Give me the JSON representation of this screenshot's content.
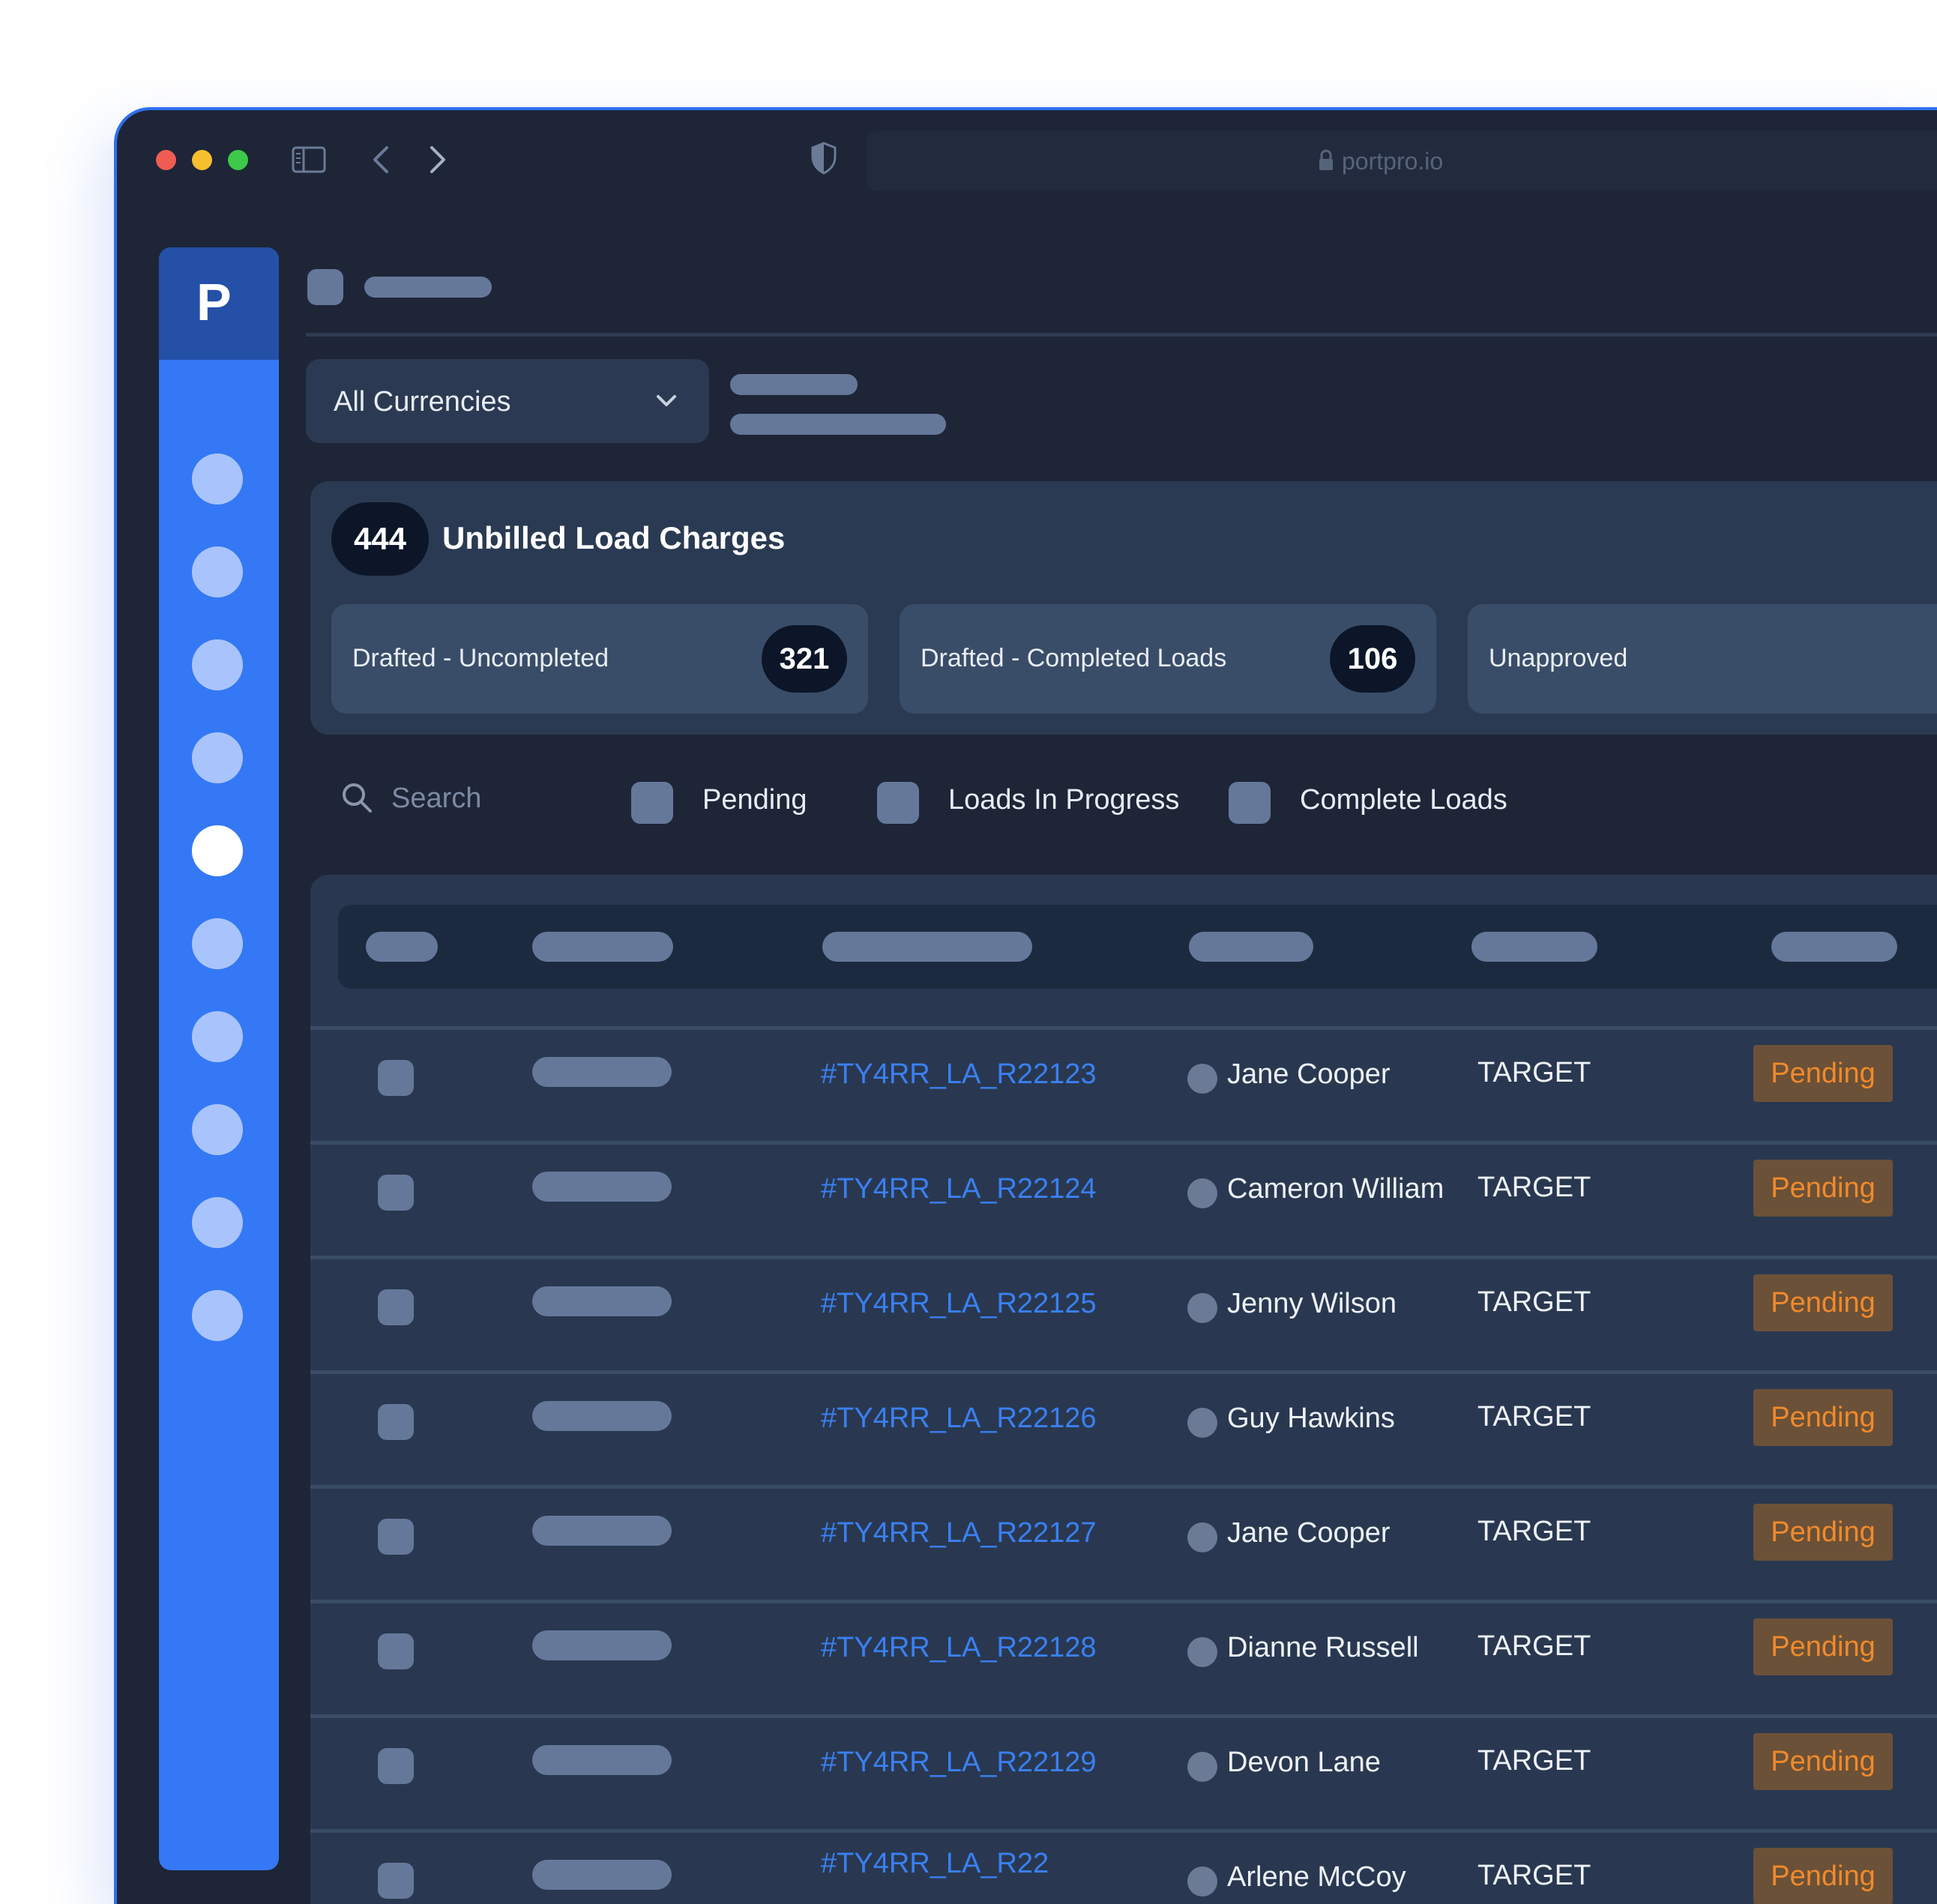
{
  "browser": {
    "url": "portpro.io",
    "traffic_lights": [
      "#ee5c53",
      "#f5bf2f",
      "#3dc94a"
    ]
  },
  "sidebar": {
    "logo": "P",
    "active_index": 4
  },
  "currency_select": {
    "value": "All Currencies"
  },
  "summary": {
    "total_count": "444",
    "title": "Unbilled Load Charges",
    "cards": [
      {
        "label": "Drafted - Uncompleted",
        "count": "321"
      },
      {
        "label": "Drafted - Completed Loads",
        "count": "106"
      },
      {
        "label": "Unapproved",
        "count": ""
      }
    ]
  },
  "filters": {
    "search_placeholder": "Search",
    "options": [
      "Pending",
      "Loads In Progress",
      "Complete Loads"
    ]
  },
  "rows": [
    {
      "id": "#TY4RR_LA_R22123",
      "name": "Jane Cooper",
      "customer": "TARGET",
      "status": "Pending"
    },
    {
      "id": "#TY4RR_LA_R22124",
      "name": "Cameron William",
      "customer": "TARGET",
      "status": "Pending"
    },
    {
      "id": "#TY4RR_LA_R22125",
      "name": "Jenny Wilson",
      "customer": "TARGET",
      "status": "Pending"
    },
    {
      "id": "#TY4RR_LA_R22126",
      "name": "Guy Hawkins",
      "customer": "TARGET",
      "status": "Pending"
    },
    {
      "id": "#TY4RR_LA_R22127",
      "name": "Jane Cooper",
      "customer": "TARGET",
      "status": "Pending"
    },
    {
      "id": "#TY4RR_LA_R22128",
      "name": "Dianne Russell",
      "customer": "TARGET",
      "status": "Pending"
    },
    {
      "id": "#TY4RR_LA_R22129",
      "name": "Devon Lane",
      "customer": "TARGET",
      "status": "Pending"
    },
    {
      "id": "#TY4RR_LA_R22",
      "name": "Arlene McCoy",
      "customer": "TARGET",
      "status": "Pending"
    }
  ],
  "colors": {
    "accent": "#3478f5",
    "link": "#3a80f2",
    "pending_text": "#f08a2c",
    "pending_bg": "#6b5137",
    "window_bg": "#1d2537"
  }
}
